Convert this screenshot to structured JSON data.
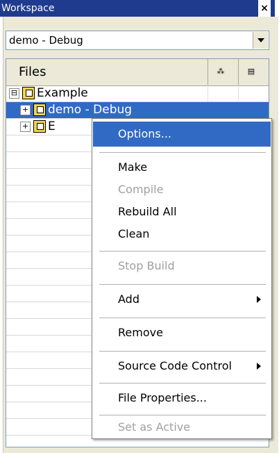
{
  "window": {
    "title": "Workspace",
    "close_label": "×"
  },
  "config_combo": {
    "value": "demo - Debug"
  },
  "grid": {
    "header": {
      "files_label": "Files"
    },
    "tree": [
      {
        "label": "Example",
        "expander": "⊟"
      },
      {
        "label": "demo - Debug",
        "expander": "+"
      },
      {
        "label": "E",
        "expander": "+"
      }
    ]
  },
  "context_menu": {
    "items": [
      {
        "label": "Options...",
        "state": "highlighted"
      },
      {
        "label": "Make",
        "state": "enabled"
      },
      {
        "label": "Compile",
        "state": "disabled"
      },
      {
        "label": "Rebuild All",
        "state": "enabled"
      },
      {
        "label": "Clean",
        "state": "enabled"
      },
      {
        "label": "Stop Build",
        "state": "disabled"
      },
      {
        "label": "Add",
        "state": "enabled",
        "submenu": true
      },
      {
        "label": "Remove",
        "state": "enabled"
      },
      {
        "label": "Source Code Control",
        "state": "enabled",
        "submenu": true
      },
      {
        "label": "File Properties...",
        "state": "enabled"
      },
      {
        "label": "Set as Active",
        "state": "disabled"
      }
    ]
  },
  "colors": {
    "title_bg": "#1f3b8d",
    "selection": "#316ac5",
    "panel_bg": "#ece9d8"
  }
}
